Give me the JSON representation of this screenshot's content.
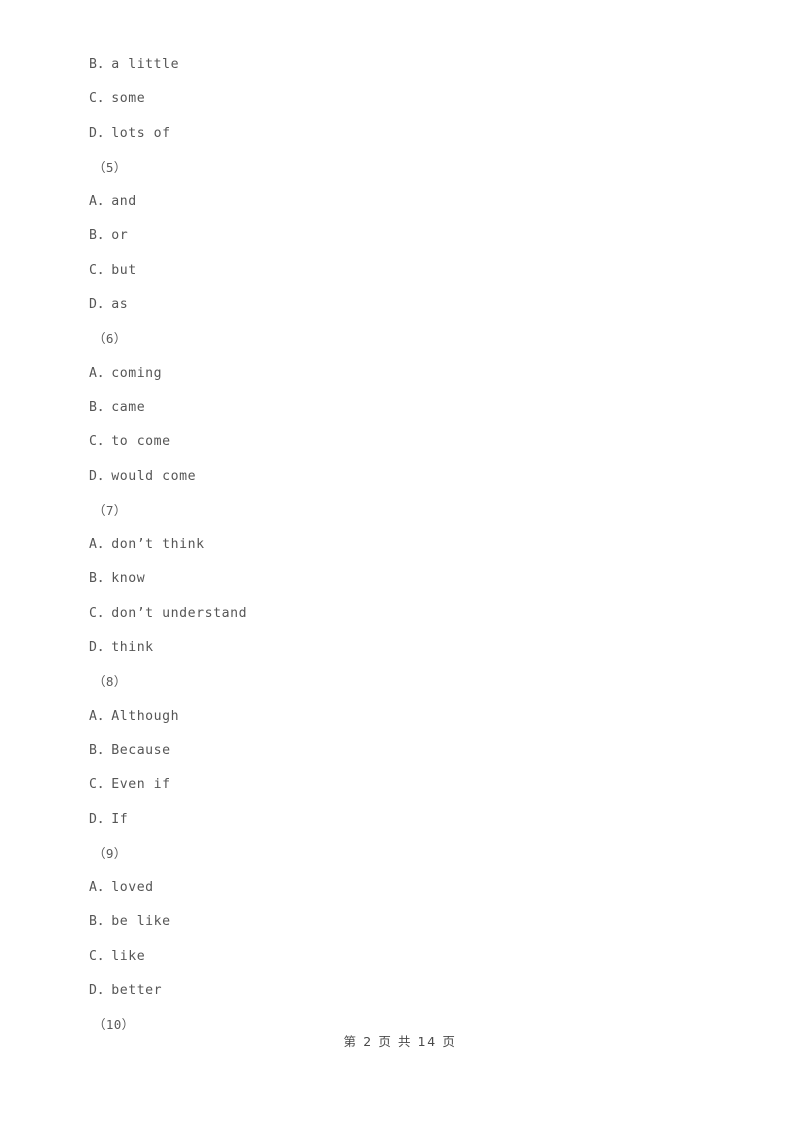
{
  "document": {
    "background_color": "#ffffff",
    "text_color": "#565656",
    "lines": [
      {
        "kind": "option",
        "text": "B．a little"
      },
      {
        "kind": "option",
        "text": "C．some"
      },
      {
        "kind": "option",
        "text": "D．lots of"
      },
      {
        "kind": "question",
        "text": "（5）"
      },
      {
        "kind": "option",
        "text": "A．and"
      },
      {
        "kind": "option",
        "text": "B．or"
      },
      {
        "kind": "option",
        "text": "C．but"
      },
      {
        "kind": "option",
        "text": "D．as"
      },
      {
        "kind": "question",
        "text": "（6）"
      },
      {
        "kind": "option",
        "text": "A．coming"
      },
      {
        "kind": "option",
        "text": "B．came"
      },
      {
        "kind": "option",
        "text": "C．to come"
      },
      {
        "kind": "option",
        "text": "D．would come"
      },
      {
        "kind": "question",
        "text": "（7）"
      },
      {
        "kind": "option",
        "text": "A．don’t think"
      },
      {
        "kind": "option",
        "text": "B．know"
      },
      {
        "kind": "option",
        "text": "C．don’t understand"
      },
      {
        "kind": "option",
        "text": "D．think"
      },
      {
        "kind": "question",
        "text": "（8）"
      },
      {
        "kind": "option",
        "text": "A．Although"
      },
      {
        "kind": "option",
        "text": "B．Because"
      },
      {
        "kind": "option",
        "text": "C．Even if"
      },
      {
        "kind": "option",
        "text": "D．If"
      },
      {
        "kind": "question",
        "text": "（9）"
      },
      {
        "kind": "option",
        "text": "A．loved"
      },
      {
        "kind": "option",
        "text": "B．be like"
      },
      {
        "kind": "option",
        "text": "C．like"
      },
      {
        "kind": "option",
        "text": "D．better"
      },
      {
        "kind": "question",
        "text": "（10）"
      }
    ]
  },
  "footer": {
    "text": "第 2 页 共 14 页",
    "current_page": "2",
    "total_pages": "14"
  }
}
